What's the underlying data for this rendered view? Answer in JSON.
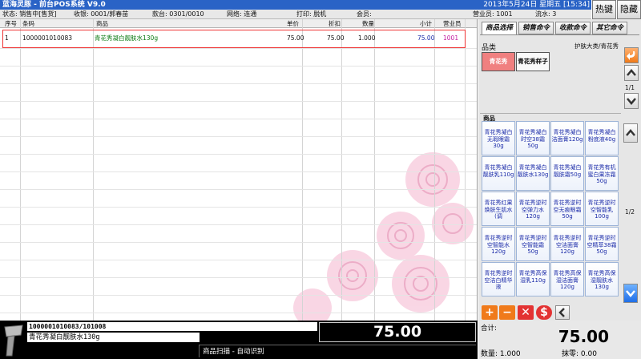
{
  "title_bar": {
    "title": "蓝海灵豚 - 前台POS系统 V9.0",
    "datetime": "2013年5月24日 星期五 [15:34]"
  },
  "hot_buttons": [
    "热键",
    "隐藏"
  ],
  "status_bar": {
    "status": "状态: 销售中[售货]",
    "cashier": "收银: 0001/郭春苗",
    "register": "款台: 0301/0010",
    "network": "网络: 连通",
    "printer": "打印: 脱机",
    "member": "会员:",
    "salesperson": "营业员: 1001",
    "serial": "流水: 3"
  },
  "table": {
    "columns": [
      "序号",
      "条码",
      "商品",
      "单价",
      "折扣",
      "数量",
      "小计",
      "营业员"
    ],
    "rows": [
      {
        "no": "1",
        "barcode": "1000001010083",
        "name": "青花秀凝白靓肤水130g",
        "price": "75.00",
        "discount": "75.00",
        "qty": "1.000",
        "subtotal": "75.00",
        "clerk": "1001"
      }
    ]
  },
  "tabs": [
    "商品选择",
    "销售命令",
    "收款命令",
    "其它命令"
  ],
  "category": {
    "title": "品类",
    "path": "护肤大类/青花秀",
    "items": [
      "青花秀",
      "青花秀样子"
    ],
    "page": "1/1"
  },
  "products": {
    "title": "商品",
    "page": "1/2",
    "items": [
      "青花秀凝白无瑕眼霜30g",
      "青花秀凝白时空38霜50g",
      "青花秀凝白洁面膏120g",
      "青花秀凝白粉底液40g",
      "青花秀凝白靓肤乳110g",
      "青花秀凝白靓肤水130g",
      "青花秀凝白靓肤霜50g",
      "青花秀有机蜜白果冻霜50g",
      "青花秀红果焕肤生肌水(调",
      "青花秀逆时空弹力水120g",
      "青花秀逆时空无痕眼霜50g",
      "青花秀逆时空智能乳100g",
      "青花秀逆时空智能水120g",
      "青花秀逆时空智能霜50g",
      "青花秀逆时空洁面膏120g",
      "青花秀逆时空精萃38霜50g",
      "青花秀逆时空洁白精华液",
      "青花秀高保湿乳110g",
      "青花秀高保湿洁面膏120g",
      "青花秀高保湿靓肤水130g"
    ]
  },
  "tool_buttons": [
    "+",
    "−",
    "✕",
    "$"
  ],
  "bottom": {
    "scan_code": "1000001010083/101008",
    "scan_name": "青花秀凝白靓肤水130g",
    "big_amount": "75.00",
    "mode": "商品扫描 - 自动识别",
    "total_label": "合计:",
    "total_value": "75.00",
    "qty_label": "数量: 1.000",
    "round_label": "抹零: 0.00"
  },
  "colors": {
    "titlebar": "#2a63c6",
    "accent_red": "#e33333",
    "product_text": "#1a2aa8",
    "tool_orange": "#f07a1a"
  }
}
